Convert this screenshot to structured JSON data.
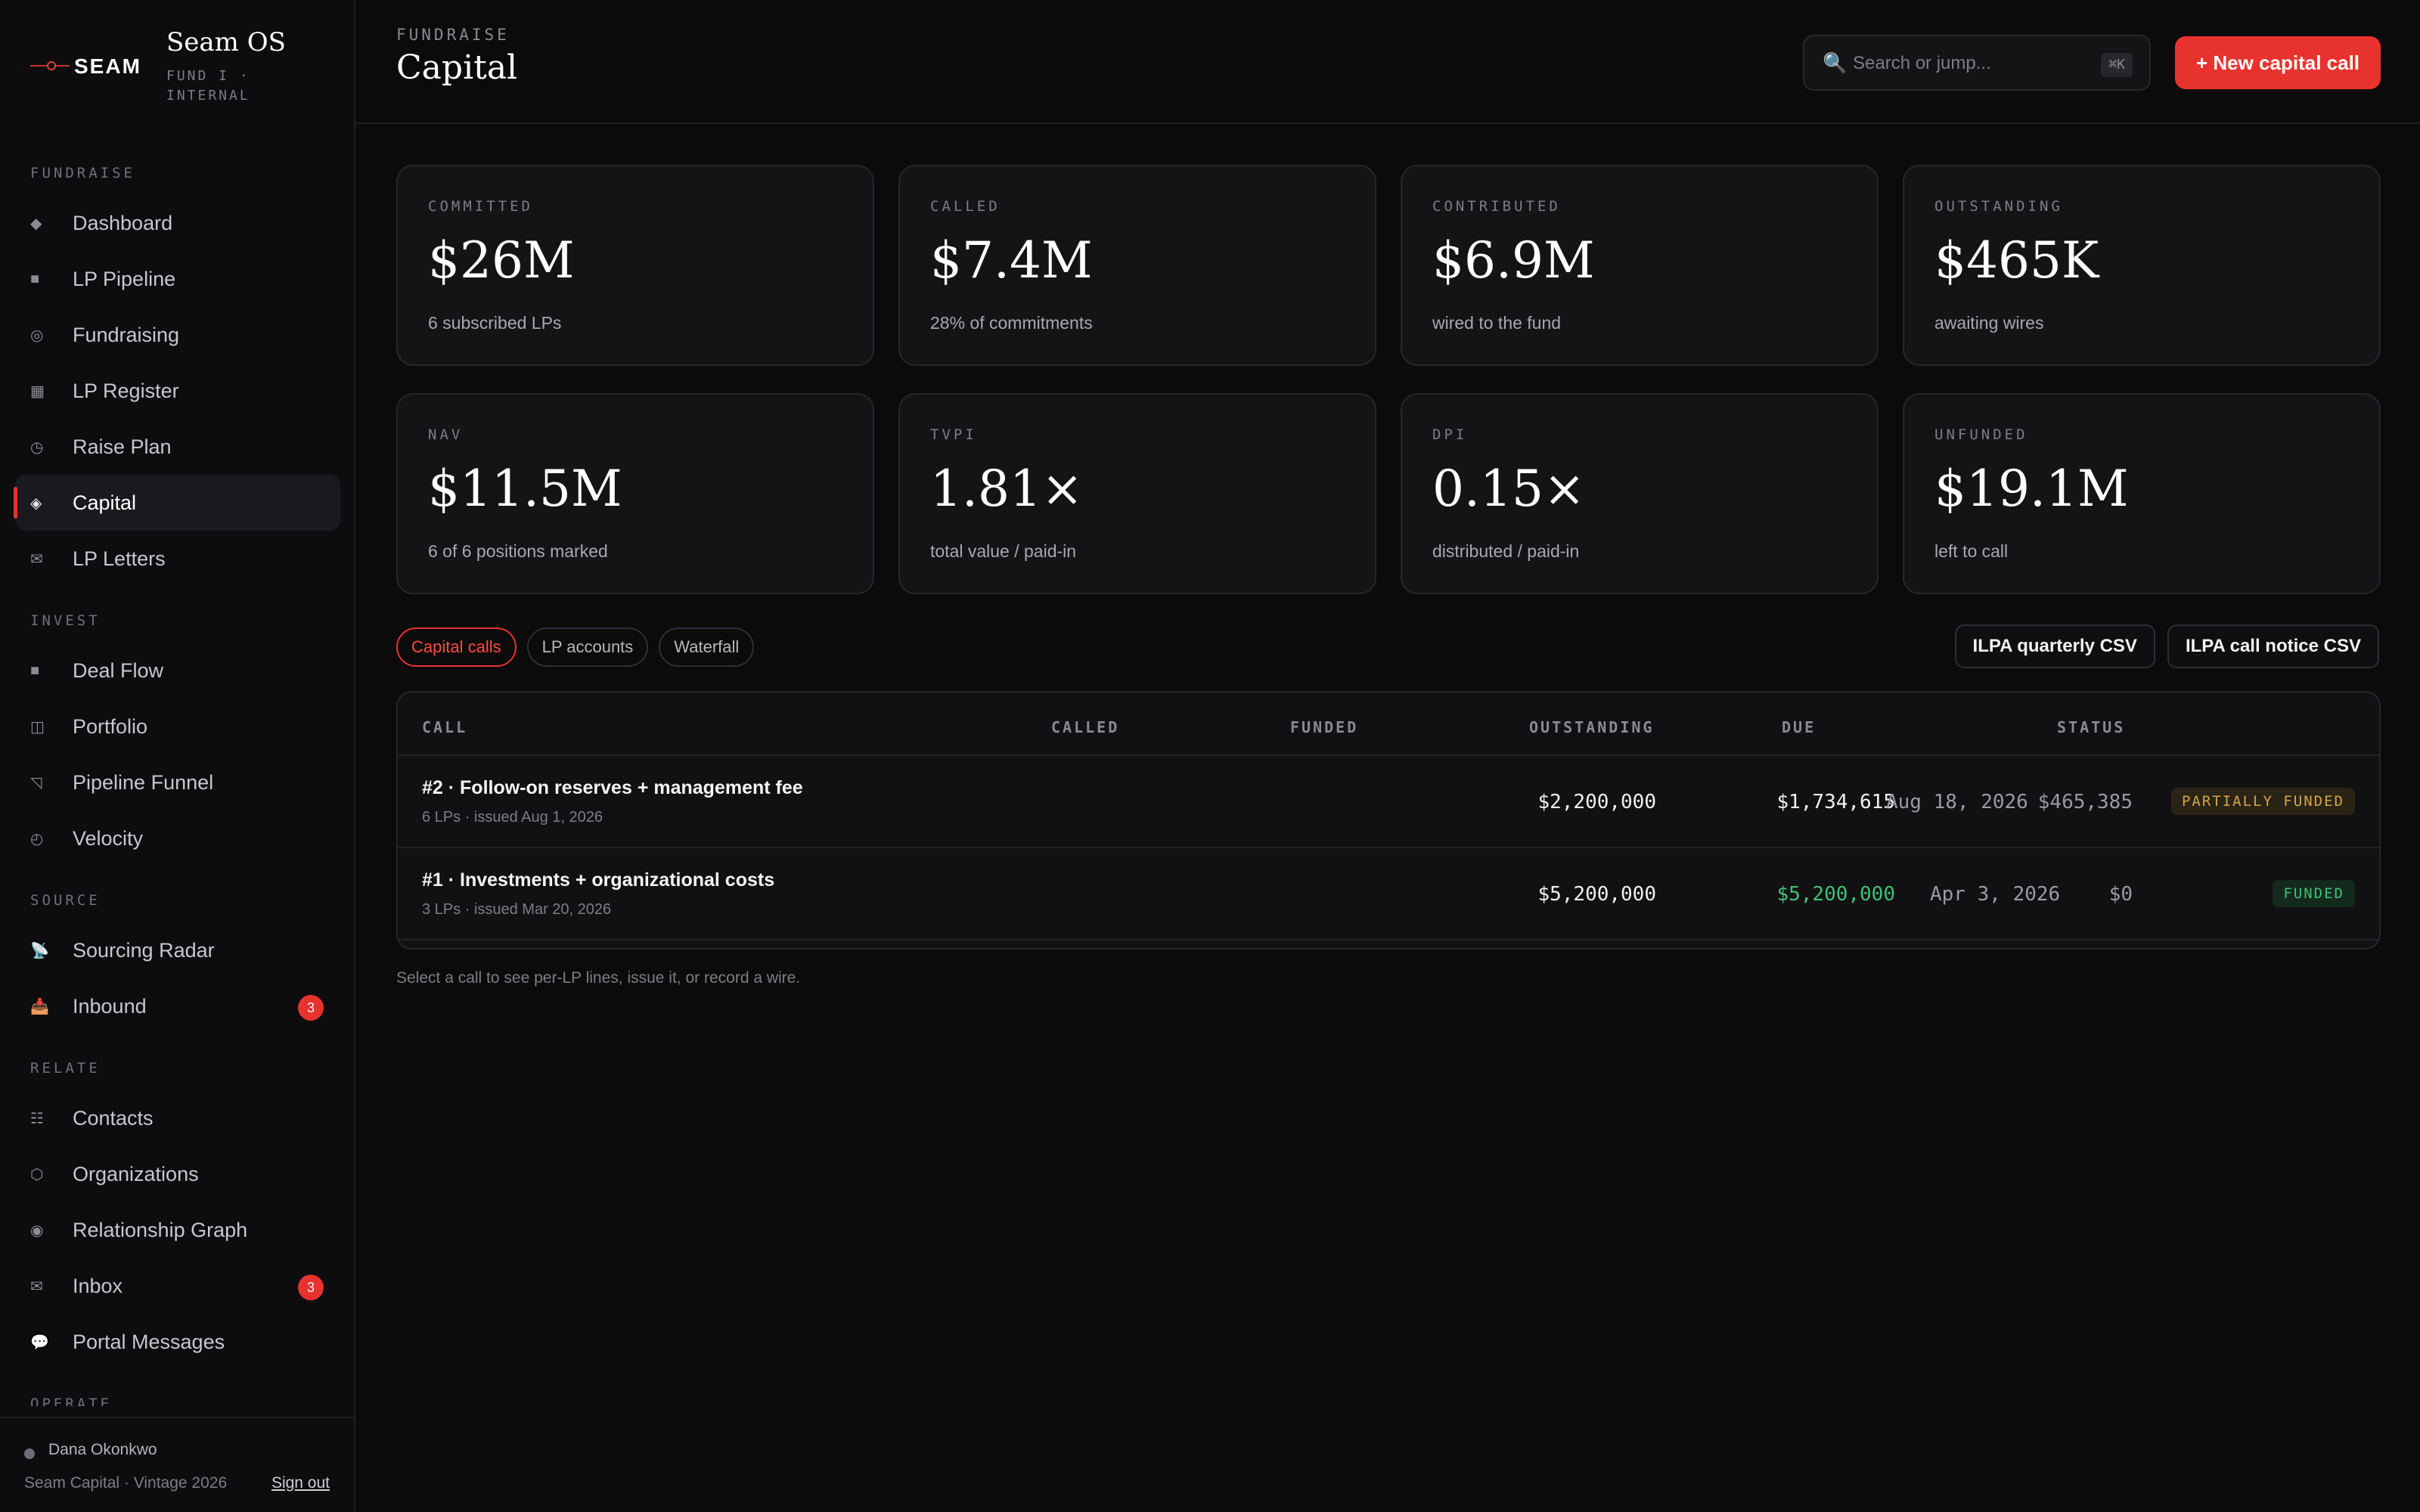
{
  "brand": {
    "wordmark": "SEAM",
    "app_name": "Seam OS",
    "fund_line": "FUND I · INTERNAL"
  },
  "sidebar": {
    "sections": [
      {
        "label": "FUNDRAISE",
        "items": [
          {
            "label": "Dashboard",
            "icon": "diamond-icon"
          },
          {
            "label": "LP Pipeline",
            "icon": "square-icon"
          },
          {
            "label": "Fundraising",
            "icon": "target-icon"
          },
          {
            "label": "LP Register",
            "icon": "register-icon"
          },
          {
            "label": "Raise Plan",
            "icon": "clock-icon"
          },
          {
            "label": "Capital",
            "icon": "diamond-outline-icon",
            "active": true
          },
          {
            "label": "LP Letters",
            "icon": "envelope-icon"
          }
        ]
      },
      {
        "label": "INVEST",
        "items": [
          {
            "label": "Deal Flow",
            "icon": "square-icon"
          },
          {
            "label": "Portfolio",
            "icon": "columns-icon"
          },
          {
            "label": "Pipeline Funnel",
            "icon": "funnel-icon"
          },
          {
            "label": "Velocity",
            "icon": "timer-icon"
          }
        ]
      },
      {
        "label": "SOURCE",
        "items": [
          {
            "label": "Sourcing Radar",
            "icon": "satellite-icon"
          },
          {
            "label": "Inbound",
            "icon": "inbox-tray-icon",
            "badge": "3"
          }
        ]
      },
      {
        "label": "RELATE",
        "items": [
          {
            "label": "Contacts",
            "icon": "list-icon"
          },
          {
            "label": "Organizations",
            "icon": "hexagon-icon"
          },
          {
            "label": "Relationship Graph",
            "icon": "graph-icon"
          },
          {
            "label": "Inbox",
            "icon": "envelope-icon",
            "badge": "3"
          },
          {
            "label": "Portal Messages",
            "icon": "speech-bubble-icon"
          }
        ]
      },
      {
        "label": "OPERATE",
        "items": []
      }
    ]
  },
  "user": {
    "name": "Dana Okonkwo",
    "org": "Seam Capital · Vintage 2026",
    "sign_out": "Sign out"
  },
  "header": {
    "eyebrow": "FUNDRAISE",
    "title": "Capital",
    "search_placeholder": "Search or jump...",
    "search_shortcut": "⌘K",
    "new_button": "+ New capital call"
  },
  "metrics": [
    {
      "label": "COMMITTED",
      "value": "$26M",
      "sub": "6 subscribed LPs"
    },
    {
      "label": "CALLED",
      "value": "$7.4M",
      "sub": "28% of commitments"
    },
    {
      "label": "CONTRIBUTED",
      "value": "$6.9M",
      "sub": "wired to the fund"
    },
    {
      "label": "OUTSTANDING",
      "value": "$465K",
      "sub": "awaiting wires"
    },
    {
      "label": "NAV",
      "value": "$11.5M",
      "sub": "6 of 6 positions marked"
    },
    {
      "label": "TVPI",
      "value": "1.81×",
      "sub": "total value / paid-in"
    },
    {
      "label": "DPI",
      "value": "0.15×",
      "sub": "distributed / paid-in"
    },
    {
      "label": "UNFUNDED",
      "value": "$19.1M",
      "sub": "left to call"
    }
  ],
  "tabs": [
    "Capital calls",
    "LP accounts",
    "Waterfall"
  ],
  "exports": [
    "ILPA quarterly CSV",
    "ILPA call notice CSV"
  ],
  "table": {
    "columns": [
      "CALL",
      "CALLED",
      "FUNDED",
      "OUTSTANDING",
      "DUE",
      "STATUS"
    ],
    "rows": [
      {
        "name": "#2 · Follow-on reserves + management fee",
        "meta": "6 LPs · issued Aug 1, 2026",
        "called": "$2,200,000",
        "funded": "$1,734,615",
        "outstanding": "$465,385",
        "due": "Aug 18, 2026",
        "status": "PARTIALLY FUNDED"
      },
      {
        "name": "#1 · Investments + organizational costs",
        "meta": "3 LPs · issued Mar 20, 2026",
        "called": "$5,200,000",
        "funded": "$5,200,000",
        "outstanding": "$0",
        "due": "Apr 3, 2026",
        "status": "FUNDED"
      }
    ]
  },
  "hint": "Select a call to see per-LP lines, issue it, or record a wire.",
  "colors": {
    "accent": "#e8322d",
    "funded": "#3fc178",
    "partial": "#d3a44a",
    "background": "#0b0b0c"
  }
}
